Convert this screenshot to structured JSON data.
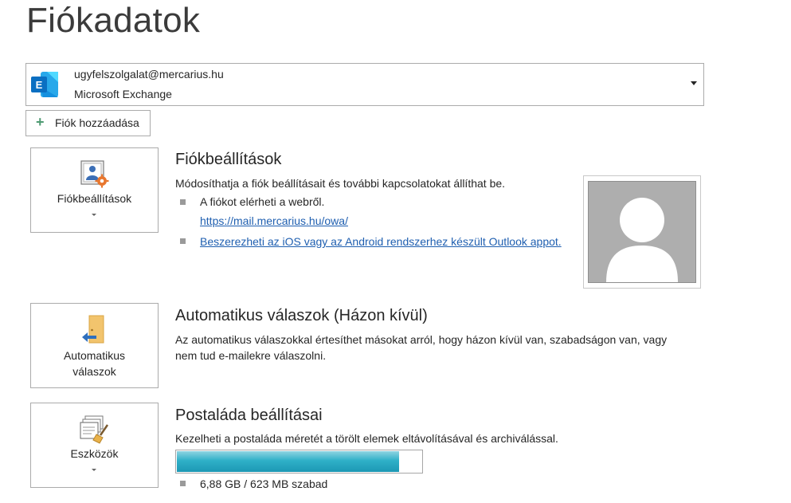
{
  "page": {
    "title": "Fiókadatok"
  },
  "account": {
    "email": "ugyfelszolgalat@mercarius.hu",
    "type": "Microsoft Exchange",
    "logo_icon": "exchange-logo-icon",
    "brand_color": "#0a6fc2"
  },
  "add_account": {
    "label": "Fiók hozzáadása",
    "icon": "plus-icon"
  },
  "account_settings": {
    "tile_label": "Fiókbeállítások",
    "title": "Fiókbeállítások",
    "description": "Módosíthatja a fiók beállításait és további kapcsolatokat állíthat be.",
    "bullets": [
      {
        "text": "A fiókot elérheti a webről.",
        "link": "https://mail.mercarius.hu/owa/"
      },
      {
        "link": "Beszerezheti az iOS vagy az Android rendszerhez készült Outlook appot."
      }
    ]
  },
  "auto_replies": {
    "tile_label_line1": "Automatikus",
    "tile_label_line2": "válaszok",
    "title": "Automatikus válaszok (Házon kívül)",
    "description_line1": "Az automatikus válaszokkal értesíthet másokat arról, hogy házon kívül van, szabadságon van, vagy",
    "description_line2": "nem tud e-mailekre válaszolni."
  },
  "mailbox": {
    "tile_label": "Eszközök",
    "title": "Postaláda beállításai",
    "description": "Kezelheti a postaláda méretét a törölt elemek eltávolításával és archiválással.",
    "usage_text": "6,88 GB / 623 MB szabad",
    "free_fraction": 0.91,
    "bar_color": "#2fb0c8"
  },
  "colors": {
    "link": "#1f5fb0",
    "accent_green": "#4f9b73",
    "tile_border": "#ababab"
  }
}
